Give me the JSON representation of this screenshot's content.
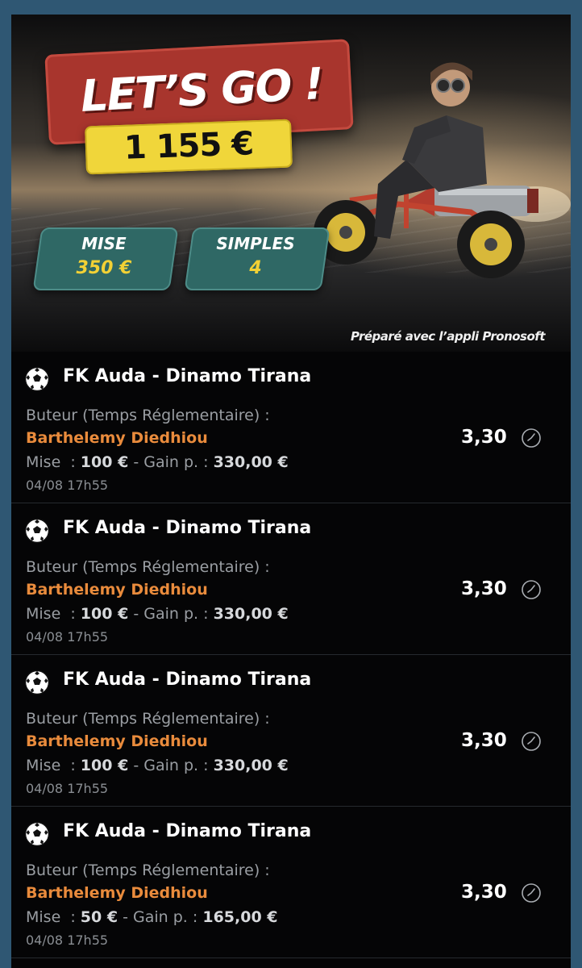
{
  "hero": {
    "title": "LET’S GO !",
    "amount": "1 155 €",
    "stats": [
      {
        "label": "MISE",
        "value": "350 €"
      },
      {
        "label": "SIMPLES",
        "value": "4"
      }
    ],
    "credit": "Préparé avec l’appli Pronosoft",
    "colors": {
      "banner_red": "#a8352d",
      "banner_yellow": "#f0d63a",
      "stat_teal": "#2f6865",
      "stat_value": "#f2d135"
    }
  },
  "bets": [
    {
      "match": "FK Auda - Dinamo Tirana",
      "market": "Buteur (Temps Réglementaire) :",
      "player": "Barthelemy Diedhiou",
      "mise_label": "Mise",
      "mise_value": "100 €",
      "gain_label": "Gain p. :",
      "gain_value": "330,00 €",
      "date": "04/08 17h55",
      "odds": "3,30"
    },
    {
      "match": "FK Auda - Dinamo Tirana",
      "market": "Buteur (Temps Réglementaire) :",
      "player": "Barthelemy Diedhiou",
      "mise_label": "Mise",
      "mise_value": "100 €",
      "gain_label": "Gain p. :",
      "gain_value": "330,00 €",
      "date": "04/08 17h55",
      "odds": "3,30"
    },
    {
      "match": "FK Auda - Dinamo Tirana",
      "market": "Buteur (Temps Réglementaire) :",
      "player": "Barthelemy Diedhiou",
      "mise_label": "Mise",
      "mise_value": "100 €",
      "gain_label": "Gain p. :",
      "gain_value": "330,00 €",
      "date": "04/08 17h55",
      "odds": "3,30"
    },
    {
      "match": "FK Auda - Dinamo Tirana",
      "market": "Buteur (Temps Réglementaire) :",
      "player": "Barthelemy Diedhiou",
      "mise_label": "Mise",
      "mise_value": "50 €",
      "gain_label": "Gain p. :",
      "gain_value": "165,00 €",
      "date": "04/08 17h55",
      "odds": "3,30"
    }
  ],
  "icons": {
    "sport": "soccer-ball-icon",
    "status": "clock-icon"
  },
  "accent": {
    "player": "#e98b3c"
  }
}
